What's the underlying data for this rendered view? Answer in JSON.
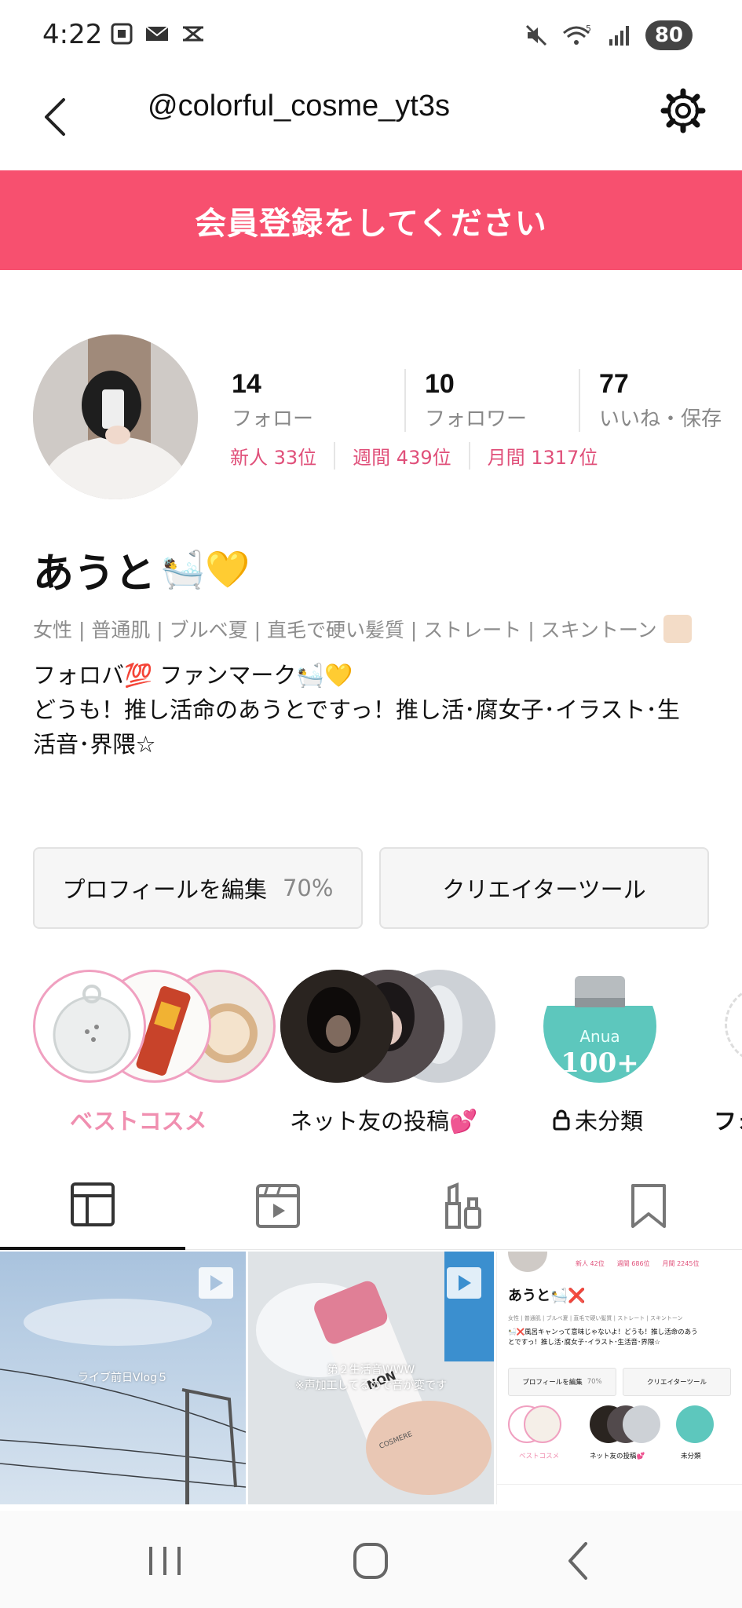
{
  "status": {
    "time": "4:22",
    "battery": "80"
  },
  "header": {
    "title": "@colorful_cosme_yt3s"
  },
  "banner": {
    "text": "会員登録をしてください",
    "color": "#f7506f"
  },
  "stats": [
    {
      "value": "14",
      "label": "フォロー"
    },
    {
      "value": "10",
      "label": "フォロワー"
    },
    {
      "value": "77",
      "label": "いいね・保存"
    }
  ],
  "ranks": [
    "新人 33位",
    "週間 439位",
    "月間 1317位"
  ],
  "profile": {
    "name": "あうと",
    "name_emojis": "🛀💛",
    "tags": "女性 | 普通肌 | ブルベ夏 | 直毛で硬い髪質 | ストレート | スキントーン",
    "bio_line1": "フォロバ💯 ファンマーク🛀💛",
    "bio_line2": "どうも！推し活命のあうとですっ！推し活･腐女子･イラスト･生",
    "bio_line3": "活音･界隈☆"
  },
  "actions": {
    "edit_label": "プロフィールを編集",
    "edit_percent": "70%",
    "creator_label": "クリエイターツール"
  },
  "collections": [
    {
      "label": "ベストコスメ",
      "color": "#f08fb0"
    },
    {
      "label": "ネット友の投稿💕",
      "color": "#111111"
    },
    {
      "label": "未分類",
      "color": "#111111"
    },
    {
      "label": "フォ",
      "color": "#111111"
    }
  ],
  "anua": {
    "brand": "Anua",
    "count": "100+"
  },
  "tabs": [
    "posts-grid",
    "videos",
    "cosmetics",
    "saved"
  ],
  "grid": {
    "cell1_caption": "ライブ前日Vlog５",
    "cell2_caption_line1": "第２生活音WWW",
    "cell2_caption_line2": "※声加工してるので音が変です",
    "cell2_bottle_text1": "NON",
    "cell2_bottle_text2": "COSMERE"
  },
  "mini_profile": {
    "ranks": [
      "新人 42位",
      "週間 686位",
      "月間 2245位"
    ],
    "name": "あうと🛀❌",
    "tags": "女性 | 普通肌 | ブルベ夏 | 直毛で硬い髪質 | ストレート | スキントーン",
    "bio_line1": "🛀❌風呂キャンって意味じゃないよ！どうも！推し活命のあう",
    "bio_line2": "とですっ！推し活･腐女子･イラスト･生活音･界隈☆",
    "edit_label": "プロフィールを編集",
    "edit_percent": "70%",
    "creator_label": "クリエイターツール",
    "coll1": "ベストコスメ",
    "coll2": "ネット友の投稿💕",
    "coll3": "未分類"
  }
}
